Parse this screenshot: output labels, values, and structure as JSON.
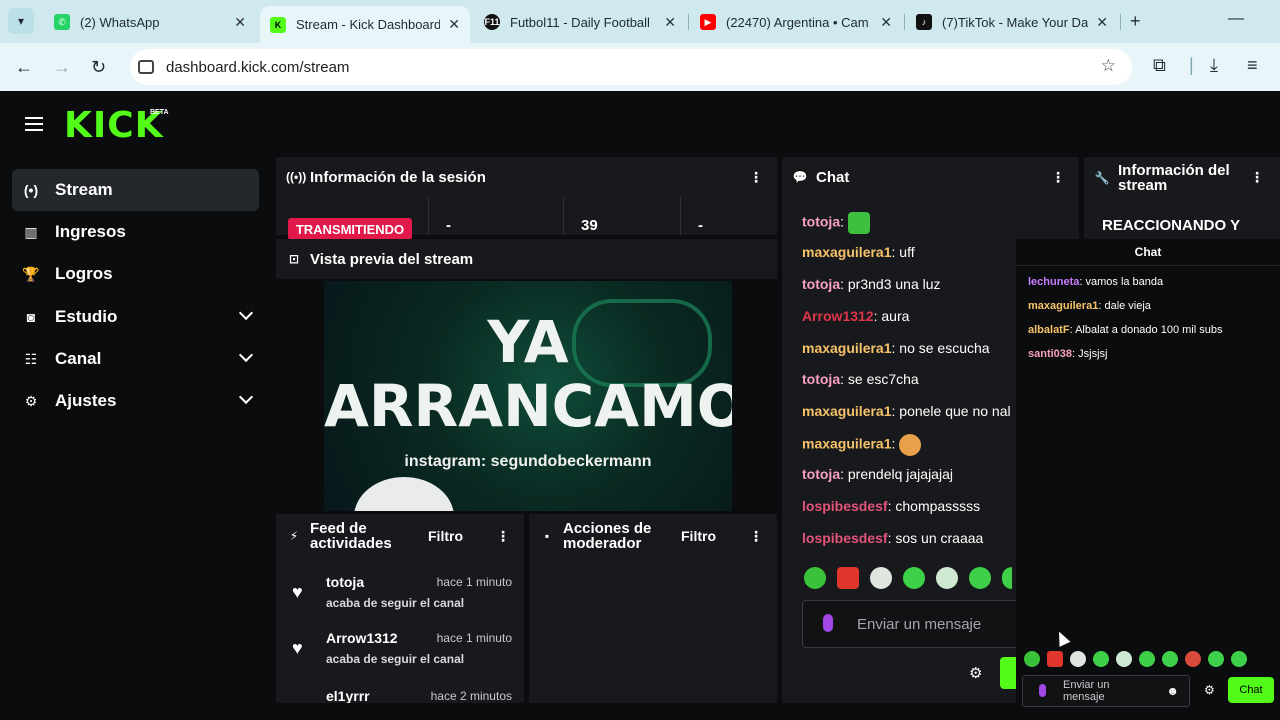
{
  "browser": {
    "tabs": [
      {
        "title": "(2) WhatsApp",
        "favicon_color": "#25d366",
        "favicon_glyph": "✆"
      },
      {
        "title": "Stream - Kick Dashboard",
        "favicon_color": "#53fc18",
        "favicon_glyph": "K"
      },
      {
        "title": "Futbol11 - Daily Football",
        "favicon_color": "#111111",
        "favicon_glyph": "F11"
      },
      {
        "title": "(22470) Argentina • Cam",
        "favicon_color": "#ff0000",
        "favicon_glyph": "▶"
      },
      {
        "title": "(7)TikTok - Make Your Da",
        "favicon_color": "#111111",
        "favicon_glyph": "♪"
      }
    ],
    "url": "dashboard.kick.com/stream"
  },
  "sidebar": {
    "items": [
      {
        "label": "Stream",
        "icon": "broadcast-icon",
        "glyph": "(•)"
      },
      {
        "label": "Ingresos",
        "icon": "chart-icon",
        "glyph": "▥"
      },
      {
        "label": "Logros",
        "icon": "trophy-icon",
        "glyph": "🏆"
      },
      {
        "label": "Estudio",
        "icon": "studio-icon",
        "glyph": "◙"
      },
      {
        "label": "Canal",
        "icon": "channel-icon",
        "glyph": "☷"
      },
      {
        "label": "Ajustes",
        "icon": "gear-icon",
        "glyph": "⚙"
      }
    ]
  },
  "logo": {
    "text": "KICK",
    "beta": "BETA"
  },
  "session": {
    "title": "Información de la sesión",
    "status": "TRANSMITIENDO",
    "stats": [
      "-",
      "39",
      "-"
    ]
  },
  "preview": {
    "title": "Vista previa del stream",
    "line1": "YA",
    "line2": "ARRANCAMOS",
    "instagram": "instagram: segundobeckermann"
  },
  "feed": {
    "title": "Feed de actividades",
    "filter": "Filtro",
    "items": [
      {
        "user": "totoja",
        "time": "hace 1 minuto",
        "action": "acaba de seguir el canal"
      },
      {
        "user": "Arrow1312",
        "time": "hace 1 minuto",
        "action": "acaba de seguir el canal"
      },
      {
        "user": "el1yrrr",
        "time": "hace 2 minutos",
        "action": ""
      }
    ]
  },
  "mod": {
    "title": "Acciones de moderador",
    "filter": "Filtro"
  },
  "chat": {
    "title": "Chat",
    "messages": [
      {
        "user": "totoja",
        "color": "#f7a0c0",
        "text": "",
        "emote": "#3fbf3f"
      },
      {
        "user": "maxaguilera1",
        "color": "#f6c36a",
        "text": "uff"
      },
      {
        "user": "totoja",
        "color": "#f7a0c0",
        "text": "pr3nd3 una luz"
      },
      {
        "user": "Arrow1312",
        "color": "#e0364b",
        "text": "aura"
      },
      {
        "user": "maxaguilera1",
        "color": "#f6c36a",
        "text": "no se escucha"
      },
      {
        "user": "totoja",
        "color": "#f7a0c0",
        "text": "se esc7cha"
      },
      {
        "user": "maxaguilera1",
        "color": "#f6c36a",
        "text": "ponele que no nal"
      },
      {
        "user": "maxaguilera1",
        "color": "#f6c36a",
        "text": "",
        "emote": "#e8a04a"
      },
      {
        "user": "totoja",
        "color": "#f7a0c0",
        "text": "prendelq jajajajaj"
      },
      {
        "user": "lospibesdesf",
        "color": "#e2537a",
        "text": "chompasssss"
      },
      {
        "user": "lospibesdesf",
        "color": "#e2537a",
        "text": "sos un craaaa"
      }
    ],
    "input_placeholder": "Enviar un mensaje"
  },
  "stream_info": {
    "title": "Información del stream",
    "stream_title": "REACCIONANDO Y"
  },
  "popout": {
    "title": "Chat",
    "messages": [
      {
        "user": "lechuneta",
        "color": "#c77dff",
        "text": "vamos la banda"
      },
      {
        "user": "maxaguilera1",
        "color": "#f6c36a",
        "text": "dale vieja"
      },
      {
        "user": "albalatF",
        "color": "#f6c36a",
        "text": "Albalat a donado 100 mil subs"
      },
      {
        "user": "santi038",
        "color": "#f7a0c0",
        "text": "Jsjsjsj"
      }
    ],
    "input_placeholder": "Enviar un mensaje",
    "send_label": "Chat"
  },
  "emotes": [
    "#39c23a",
    "#e0362c",
    "#dfe6e0",
    "#3fd04a",
    "#cfe8d2",
    "#3fd04a",
    "#3fd04a",
    "#d84a3a",
    "#3fd04a",
    "#3fd04a"
  ],
  "colors": {
    "accent": "#53fc18",
    "live": "#e0194a",
    "panel": "#18191c",
    "bg": "#0b0c0e"
  }
}
